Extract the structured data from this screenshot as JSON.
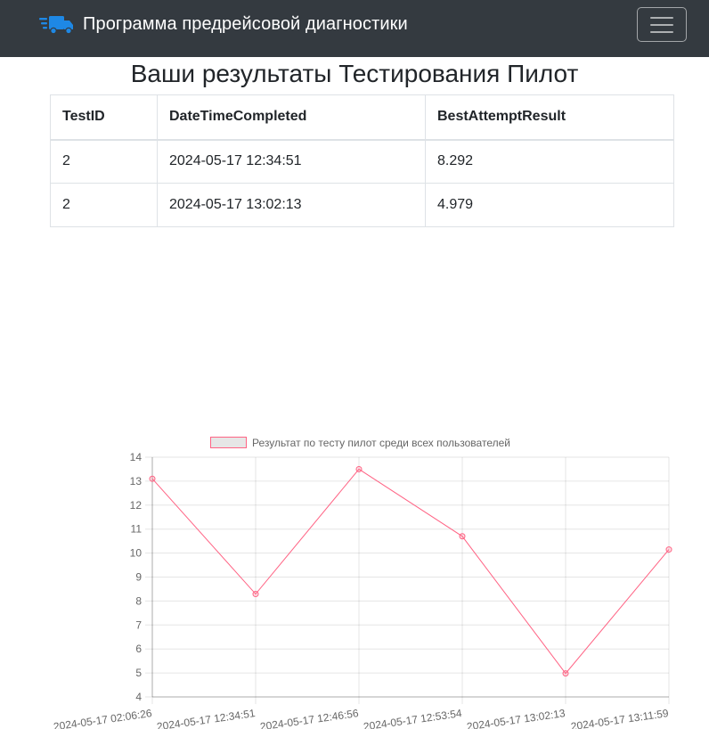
{
  "navbar": {
    "brand_text": "Программа предрейсовой диагностики",
    "brand_icon": "truck-fast-icon",
    "toggler_icon": "hamburger-menu-icon",
    "background": "#343a40",
    "icon_color": "#1e88e5"
  },
  "page_title": "Ваши результаты Тестирования Пилот",
  "table": {
    "headers": [
      "TestID",
      "DateTimeCompleted",
      "BestAttemptResult"
    ],
    "rows": [
      [
        "2",
        "2024-05-17 12:34:51",
        "8.292"
      ],
      [
        "2",
        "2024-05-17 13:02:13",
        "4.979"
      ]
    ]
  },
  "chart_data": {
    "type": "line",
    "categories": [
      "2024-05-17 02:06:26",
      "2024-05-17 12:34:51",
      "2024-05-17 12:46:56",
      "2024-05-17 12:53:54",
      "2024-05-17 13:02:13",
      "2024-05-17 13:11:59"
    ],
    "series": [
      {
        "name": "Результат по тесту пилот среди всех пользователей",
        "values": [
          13.1,
          8.292,
          13.5,
          10.7,
          4.979,
          10.15
        ],
        "color": "#ff6384"
      }
    ],
    "yticks": [
      "4",
      "5",
      "6",
      "7",
      "8",
      "9",
      "10",
      "11",
      "12",
      "13",
      "14"
    ],
    "ylim": [
      4,
      14
    ],
    "grid": true,
    "legend": "top"
  }
}
